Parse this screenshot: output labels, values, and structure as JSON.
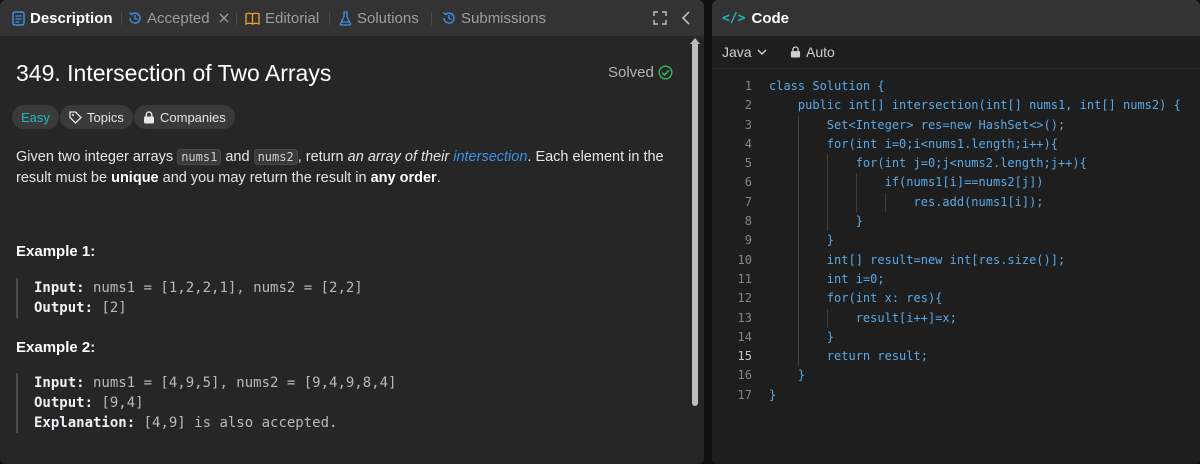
{
  "tabs": {
    "description": "Description",
    "accepted": "Accepted",
    "editorial": "Editorial",
    "solutions": "Solutions",
    "submissions": "Submissions"
  },
  "problem": {
    "title": "349. Intersection of Two Arrays",
    "status": "Solved",
    "difficulty": "Easy",
    "topics_label": "Topics",
    "companies_label": "Companies",
    "desc_1": "Given two integer arrays ",
    "desc_code1": "nums1",
    "desc_2": " and ",
    "desc_code2": "nums2",
    "desc_3": ", return ",
    "desc_em": "an array of their ",
    "desc_link": "intersection",
    "desc_4": ". Each element in the result must be ",
    "desc_b1": "unique",
    "desc_5": " and you may return the result in ",
    "desc_b2": "any order",
    "desc_6": "."
  },
  "examples": [
    {
      "title": "Example 1:",
      "input_label": "Input:",
      "input": " nums1 = [1,2,2,1], nums2 = [2,2]",
      "output_label": "Output:",
      "output": " [2]"
    },
    {
      "title": "Example 2:",
      "input_label": "Input:",
      "input": " nums1 = [4,9,5], nums2 = [9,4,9,8,4]",
      "output_label": "Output:",
      "output": " [9,4]",
      "explanation_label": "Explanation:",
      "explanation": " [4,9] is also accepted."
    }
  ],
  "code_panel": {
    "title": "Code",
    "language": "Java",
    "mode": "Auto"
  },
  "code_lines": [
    "class Solution {",
    "    public int[] intersection(int[] nums1, int[] nums2) {",
    "        Set<Integer> res=new HashSet<>();",
    "        for(int i=0;i<nums1.length;i++){",
    "            for(int j=0;j<nums2.length;j++){",
    "                if(nums1[i]==nums2[j])",
    "                    res.add(nums1[i]);",
    "            }",
    "        }",
    "        int[] result=new int[res.size()];",
    "        int i=0;",
    "        for(int x: res){",
    "            result[i++]=x;",
    "        }",
    "        return result;",
    "    }",
    "}"
  ],
  "colors": {
    "panel_bg": "#262626",
    "editor_bg": "#1e1e1e",
    "easy": "#1cbaba",
    "solved_check": "#2cbb5d",
    "link": "#3c91e6",
    "code_text": "#5aa9e6"
  }
}
